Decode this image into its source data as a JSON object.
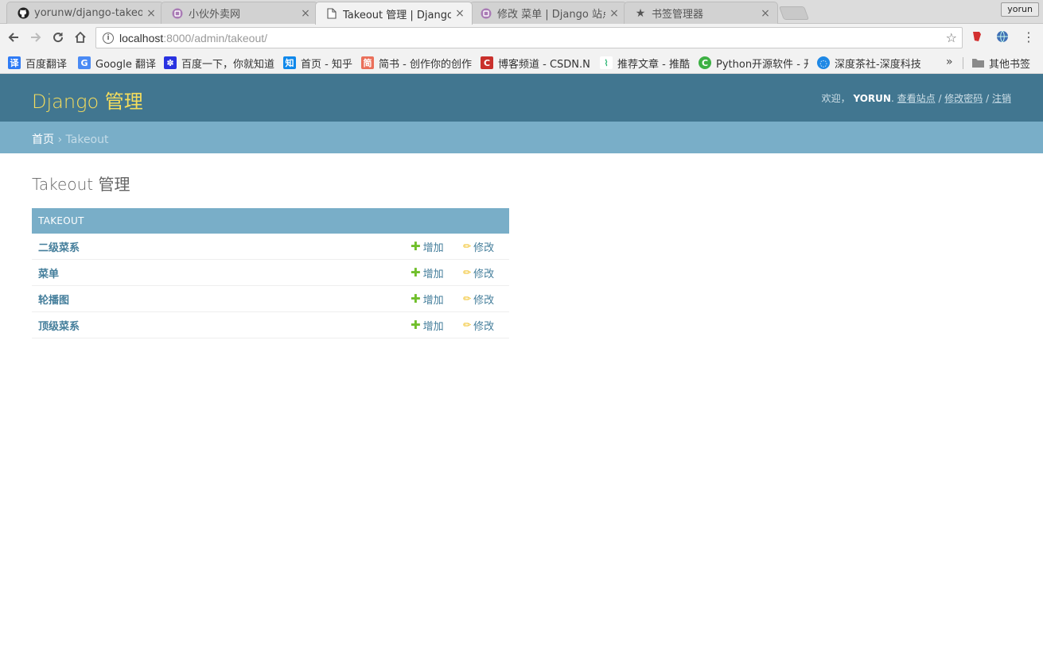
{
  "browser": {
    "tabs": [
      {
        "title": "yorunw/django-takeo",
        "icon": "github-icon"
      },
      {
        "title": "小伙外卖网",
        "icon": "django-site-icon"
      },
      {
        "title": "Takeout 管理 | Django",
        "icon": "page-icon"
      },
      {
        "title": "修改 菜单 | Django 站点",
        "icon": "django-site-icon"
      },
      {
        "title": "书签管理器",
        "icon": "star-icon"
      }
    ],
    "profile": "yorun",
    "url_host": "localhost",
    "url_rest": ":8000/admin/takeout/",
    "bookmarks": [
      "百度翻译",
      "Google 翻译",
      "百度一下，你就知道",
      "首页 - 知乎",
      "简书 - 创作你的创作",
      "博客频道 - CSDN.NET",
      "推荐文章 - 推酷",
      "Python开源软件 - 开",
      "深度茶社-深度科技"
    ],
    "other_bookmarks": "其他书签"
  },
  "admin": {
    "site_title": "Django 管理",
    "welcome": "欢迎，",
    "username": "YORUN",
    "links": {
      "view_site": "查看站点",
      "change_password": "修改密码",
      "logout": "注销"
    },
    "breadcrumb_home": "首页",
    "breadcrumb_sep": "›",
    "breadcrumb_current": "Takeout",
    "page_title": "Takeout 管理",
    "app_caption": "TAKEOUT",
    "add_label": "增加",
    "change_label": "修改",
    "models": [
      "二级菜系",
      "菜单",
      "轮播图",
      "顶级菜系"
    ]
  }
}
